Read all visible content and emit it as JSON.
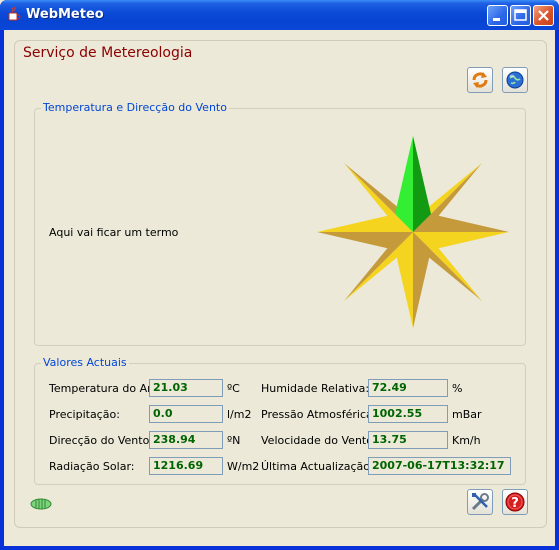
{
  "window": {
    "title": "WebMeteo",
    "icon": "java-cup-icon"
  },
  "titlebar_buttons": [
    "minimize-icon",
    "maximize-icon",
    "close-icon"
  ],
  "header": {
    "title": "Serviço de Metereologia"
  },
  "toolbar": {
    "refresh_icon": "refresh-icon",
    "globe_icon": "globe-icon"
  },
  "temp_wind_panel": {
    "legend": "Temperatura e Direcção do Vento",
    "placeholder": "Aqui vai ficar um termo",
    "wind_direction_deg": 238.94
  },
  "values_panel": {
    "legend": "Valores Actuais",
    "rows": [
      {
        "label": "Temperatura do Ar:",
        "value": "21.03",
        "unit": "ºC",
        "label2": "Humidade Relativa:",
        "value2": "72.49",
        "unit2": "%"
      },
      {
        "label": "Precipitação:",
        "value": "0.0",
        "unit": "l/m2",
        "label2": "Pressão Atmosférica:",
        "value2": "1002.55",
        "unit2": "mBar"
      },
      {
        "label": "Direcção do Vento:",
        "value": "238.94",
        "unit": "ºN",
        "label2": "Velocidade do Vento:",
        "value2": "13.75",
        "unit2": "Km/h"
      },
      {
        "label": "Radiação Solar:",
        "value": "1216.69",
        "unit": "W/m2",
        "label2": "Última Actualização:",
        "value2": "2007-06-17T13:32:17",
        "unit2": ""
      }
    ]
  },
  "footer": {
    "status_icon": "connection-status-icon",
    "settings_icon": "tools-icon",
    "help_icon": "help-icon"
  },
  "colors": {
    "accent_title": "#8B0000",
    "legend": "#0046D5",
    "value_text": "#006400",
    "needle_green": "#22CC22",
    "star_gold": "#F2C21A"
  }
}
